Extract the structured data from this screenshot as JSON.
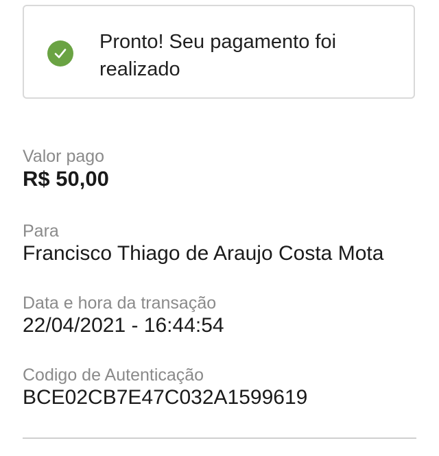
{
  "status": {
    "icon": "check-circle-icon",
    "message": "Pronto! Seu pagamento foi realizado",
    "color": "#6aa343"
  },
  "details": {
    "amount_label": "Valor pago",
    "amount_value": "R$ 50,00",
    "recipient_label": "Para",
    "recipient_value": "Francisco Thiago de Araujo Costa Mota",
    "datetime_label": "Data e hora da transação",
    "datetime_value": "22/04/2021 - 16:44:54",
    "auth_label": "Codigo de Autenticação",
    "auth_value": "BCE02CB7E47C032A1599619"
  }
}
